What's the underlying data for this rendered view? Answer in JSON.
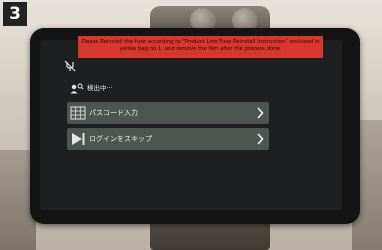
{
  "step": {
    "number": "3"
  },
  "sticker": {
    "text": "Please Reinstall the fuse according to \"Product Line Fuse Reinstall Instruction\" enclosed in yellow bag no.1, and remove the film after the process done."
  },
  "screen": {
    "status_icon": "usb-disconnected-icon",
    "searching": {
      "icon": "user-search-icon",
      "label": "検出中···"
    },
    "menu": [
      {
        "label": "パスコード入力",
        "icon": "keypad-icon"
      },
      {
        "label": "ログインをスキップ",
        "icon": "skip-icon"
      }
    ]
  },
  "colors": {
    "button_bg": "#4e5550",
    "screen_bg": "#1e1f21",
    "sticker_bg": "#d9362f"
  }
}
